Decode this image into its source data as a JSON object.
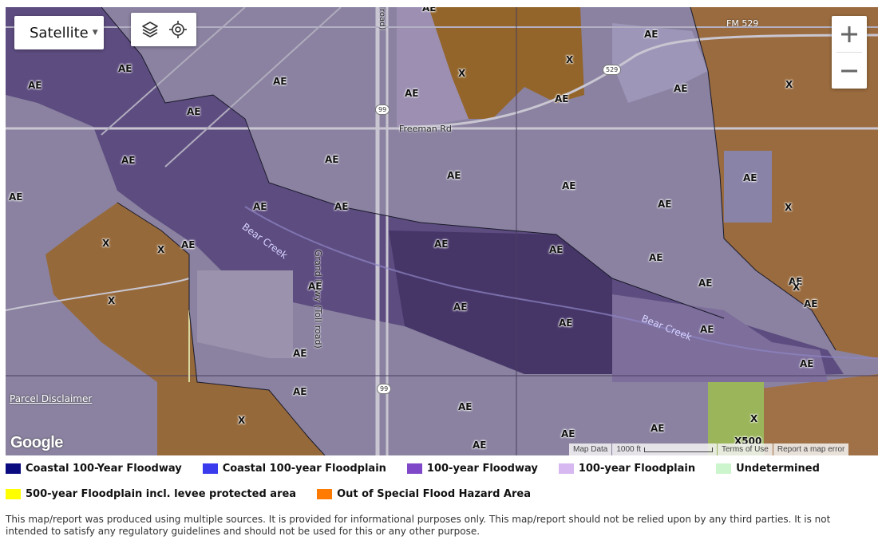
{
  "map": {
    "map_type_label": "Satellite",
    "parcel_disclaimer": "Parcel Disclaimer",
    "google_logo": "Google",
    "attribution": {
      "map_data": "Map Data",
      "scale": "1000 ft",
      "terms": "Terms of Use",
      "report": "Report a map error"
    },
    "roads": {
      "freeman": "Freeman Rd",
      "grand_parkway": "Grand Pkwy (Toll road)",
      "toll_road_top": "road)",
      "fm529": "FM 529",
      "shield_99_a": "99",
      "shield_99_b": "99",
      "shield_529": "529",
      "x500": "X500"
    },
    "creeks": {
      "bear_creek_west": "Bear Creek",
      "bear_creek_east": "Bear Creek"
    },
    "zones": [
      "AE",
      "AE",
      "AE",
      "AE",
      "AE",
      "AE",
      "AE",
      "AE",
      "AE",
      "AE",
      "AE",
      "AE",
      "AE",
      "AE",
      "AE",
      "AE",
      "AE",
      "AE",
      "AE",
      "AE",
      "AE",
      "AE",
      "AE",
      "AE",
      "AE",
      "AE",
      "AE",
      "AE",
      "AE",
      "AE",
      "AE",
      "AE",
      "AE",
      "AE",
      "AE",
      "AE",
      "X",
      "X",
      "X",
      "X",
      "X",
      "X",
      "X",
      "X",
      "X",
      "X"
    ],
    "icons": {
      "layers": "layers-icon",
      "locate": "locate-icon",
      "zoom_in": "zoom-in-icon",
      "zoom_out": "zoom-out-icon"
    }
  },
  "legend": {
    "items": [
      {
        "label": "Coastal 100-Year Floodway",
        "color": "#0b0b80"
      },
      {
        "label": "Coastal 100-year Floodplain",
        "color": "#3b3bee"
      },
      {
        "label": "100-year Floodway",
        "color": "#7f48c8"
      },
      {
        "label": "100-year Floodplain",
        "color": "#d8b8f0"
      },
      {
        "label": "Undetermined",
        "color": "#cdf5cd"
      },
      {
        "label": "500-year Floodplain incl. levee protected area",
        "color": "#ffff00"
      },
      {
        "label": "Out of Special Flood Hazard Area",
        "color": "#ff7a00"
      }
    ]
  },
  "notice": "This map/report was produced using multiple sources. It is provided for informational purposes only. This map/report should not be relied upon by any third parties. It is not intended to satisfy any regulatory guidelines and should not be used for this or any other purpose."
}
